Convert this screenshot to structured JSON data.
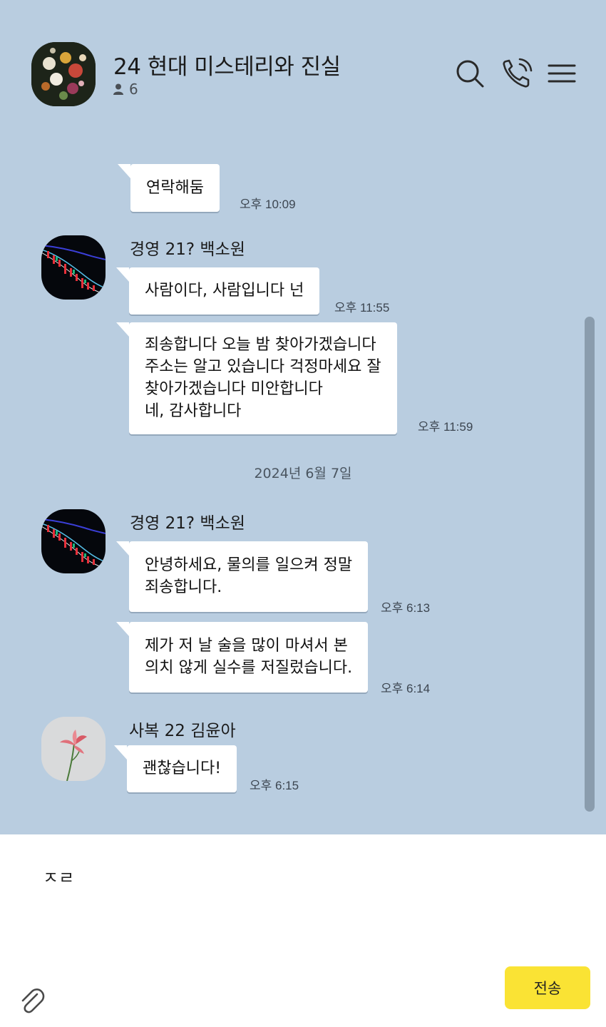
{
  "header": {
    "title": "24 현대 미스테리와 진실",
    "member_count": "6",
    "icons": [
      "search-icon",
      "call-icon",
      "menu-icon"
    ]
  },
  "messages": {
    "m0": {
      "text": "연락해둠",
      "time": "오후 10:09"
    },
    "g1": {
      "sender": "경영 21? 백소원",
      "m1": {
        "text": "사람이다, 사람입니다 넌",
        "time": "오후 11:55"
      },
      "m2": {
        "lines": [
          "죄송합니다 오늘 밤 찾아가겠습니다",
          "주소는 알고 있습니다 걱정마세요 잘",
          "찾아가겠습니다 미안합니다",
          "네, 감사합니다"
        ],
        "time": "오후 11:59"
      }
    },
    "date": "2024년 6월 7일",
    "g2": {
      "sender": "경영 21? 백소원",
      "m1": {
        "lines": [
          "안녕하세요, 물의를 일으켜 정말",
          "죄송합니다."
        ],
        "time": "오후 6:13"
      },
      "m2": {
        "lines": [
          "제가 저 날 술을 많이 마셔서 본",
          "의치 않게 실수를 저질렀습니다."
        ],
        "time": "오후 6:14"
      }
    },
    "g3": {
      "sender": "사복 22 김윤아",
      "m1": {
        "text": "괜찮습니다!",
        "time": "오후 6:15"
      }
    }
  },
  "input": {
    "value": "ㅈㄹ"
  },
  "send_label": "전송",
  "colors": {
    "chat_bg": "#b9cde0",
    "send_button": "#fae334",
    "bubble": "#ffffff"
  }
}
